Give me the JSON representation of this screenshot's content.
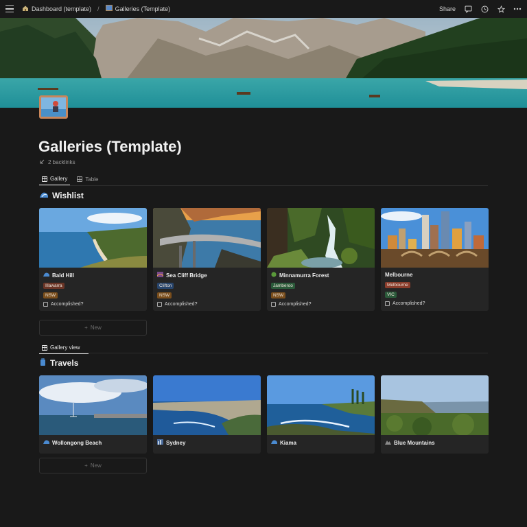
{
  "breadcrumb": {
    "items": [
      {
        "label": "Dashboard (template)",
        "icon": "house-icon"
      },
      {
        "label": "Galleries (Template)",
        "icon": "page-icon"
      }
    ],
    "separator": "/"
  },
  "topbar": {
    "share_label": "Share"
  },
  "page": {
    "title": "Galleries (Template)",
    "backlinks": "2 backlinks"
  },
  "views": {
    "tabs": [
      {
        "label": "Gallery",
        "active": true
      },
      {
        "label": "Table",
        "active": false
      }
    ]
  },
  "wishlist": {
    "title": "Wishlist",
    "cards": [
      {
        "name": "Bald Hill",
        "icon": "wave-icon",
        "region": "Illawarra",
        "state": "NSW",
        "checkbox_label": "Accomplished?"
      },
      {
        "name": "Sea Cliff Bridge",
        "icon": "bridge-icon",
        "region": "Clifton",
        "state": "NSW",
        "checkbox_label": "Accomplished?"
      },
      {
        "name": "Minnamurra Forest",
        "icon": "green-circle-icon",
        "region": "Jamberoo",
        "state": "NSW",
        "checkbox_label": "Accomplished?"
      },
      {
        "name": "Melbourne",
        "icon": "city-icon",
        "region": "Melbourne",
        "state": "VIC",
        "checkbox_label": "Accomplished?"
      }
    ],
    "new_label": "New"
  },
  "gallery_view": {
    "label": "Gallery view"
  },
  "travels": {
    "title": "Travels",
    "cards": [
      {
        "name": "Wollongong Beach",
        "icon": "wave-icon"
      },
      {
        "name": "Sydney",
        "icon": "city-icon"
      },
      {
        "name": "Kiama",
        "icon": "wave-icon"
      },
      {
        "name": "Blue Mountains",
        "icon": "mountain-icon"
      }
    ],
    "new_label": "New"
  },
  "colors": {
    "background": "#191919",
    "card": "#252525",
    "tag_region": "#8a3d2c",
    "tag_region_blue": "#28456c",
    "tag_region_green": "#2b5a3a",
    "tag_nsw": "#8a5a1f",
    "tag_vic": "#2b5a3a"
  }
}
